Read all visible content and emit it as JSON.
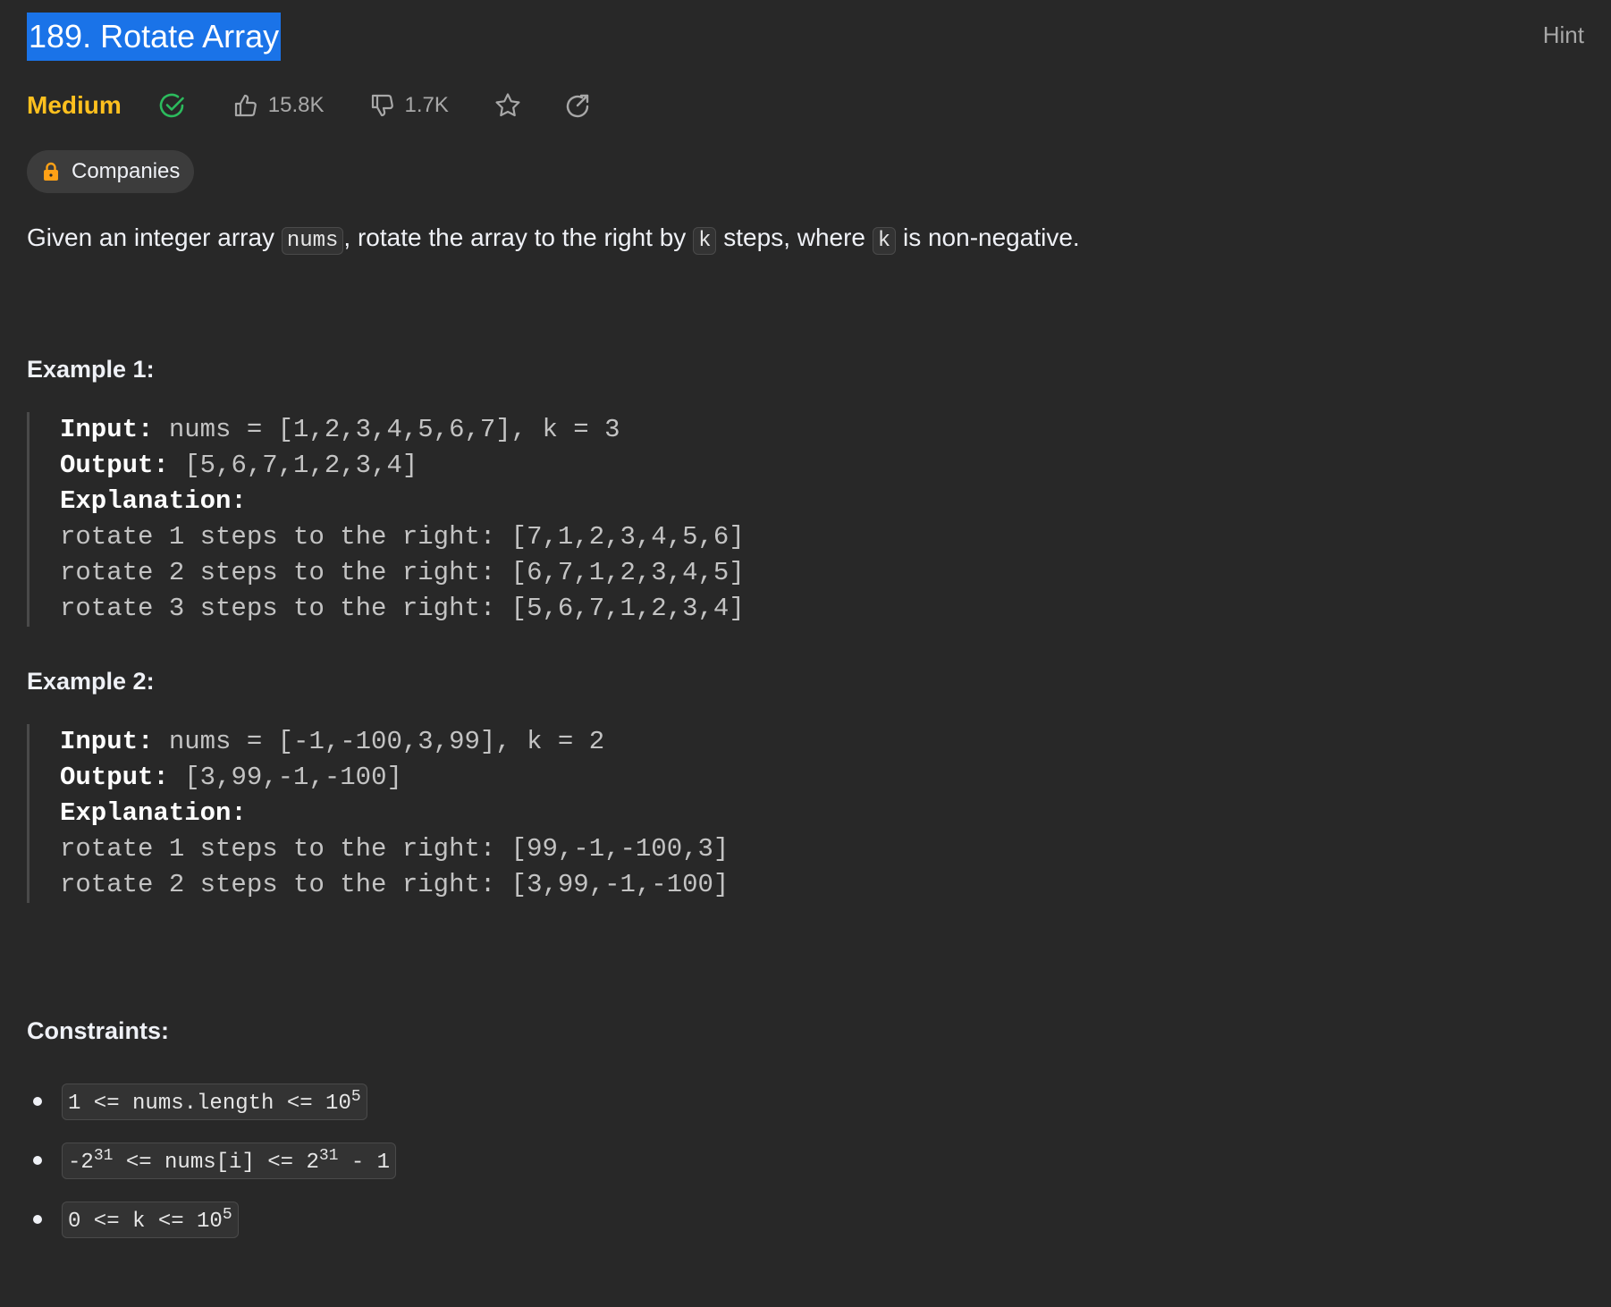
{
  "problem": {
    "title": "189. Rotate Array",
    "hint_label": "Hint",
    "difficulty": "Medium",
    "likes": "15.8K",
    "dislikes": "1.7K",
    "companies_label": "Companies"
  },
  "description": {
    "part1": "Given an integer array ",
    "code1": "nums",
    "part2": ", rotate the array to the right by ",
    "code2": "k",
    "part3": " steps, where ",
    "code3": "k",
    "part4": " is non-negative."
  },
  "example1": {
    "title": "Example 1:",
    "input_label": "Input:",
    "input_value": " nums = [1,2,3,4,5,6,7], k = 3",
    "output_label": "Output:",
    "output_value": " [5,6,7,1,2,3,4]",
    "explanation_label": "Explanation:",
    "lines": [
      "rotate 1 steps to the right: [7,1,2,3,4,5,6]",
      "rotate 2 steps to the right: [6,7,1,2,3,4,5]",
      "rotate 3 steps to the right: [5,6,7,1,2,3,4]"
    ]
  },
  "example2": {
    "title": "Example 2:",
    "input_label": "Input:",
    "input_value": " nums = [-1,-100,3,99], k = 2",
    "output_label": "Output:",
    "output_value": " [3,99,-1,-100]",
    "explanation_label": "Explanation:",
    "lines": [
      "rotate 1 steps to the right: [99,-1,-100,3]",
      "rotate 2 steps to the right: [3,99,-1,-100]"
    ]
  },
  "constraints": {
    "title": "Constraints:",
    "c1": {
      "pre": "1 <= nums.length <= 10",
      "sup": "5",
      "post": ""
    },
    "c2": {
      "pre": "-2",
      "sup": "31",
      "mid": " <= nums[i] <= 2",
      "sup2": "31",
      "post": " - 1"
    },
    "c3": {
      "pre": "0 <= k <= 10",
      "sup": "5",
      "post": ""
    }
  },
  "colors": {
    "background": "#282828",
    "difficulty_medium": "#ffc01e",
    "solved_green": "#2cbb5d",
    "title_highlight": "#1a73e8"
  },
  "icons": [
    "check-circle-icon",
    "thumbs-up-icon",
    "thumbs-down-icon",
    "star-icon",
    "share-icon",
    "lock-icon"
  ]
}
